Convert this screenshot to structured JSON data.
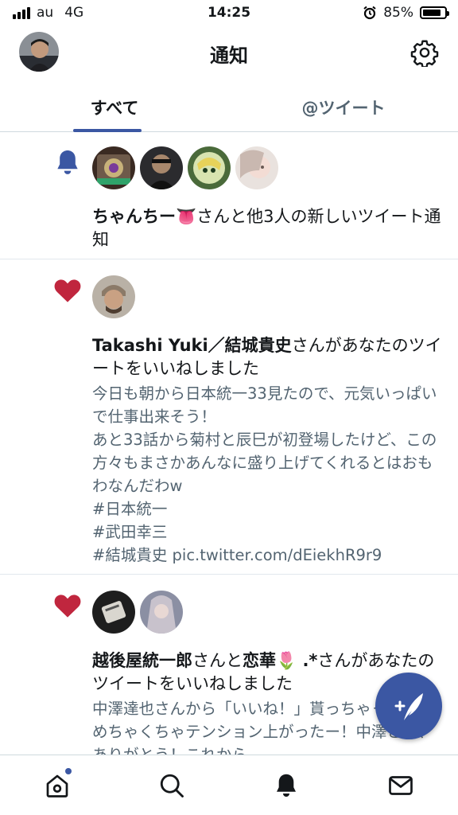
{
  "status": {
    "carrier": "au",
    "network": "4G",
    "time": "14:25",
    "battery_percent": "85%",
    "battery_level": 0.85
  },
  "header": {
    "title": "通知"
  },
  "tabs": [
    {
      "label": "すべて",
      "active": true
    },
    {
      "label": "@ツイート",
      "active": false
    }
  ],
  "notifications": [
    {
      "type": "bell-icon",
      "avatar_count": 4,
      "name": "ちゃんちー👅",
      "text": "さんと他3人の新しいツイート通知",
      "body": ""
    },
    {
      "type": "heart-icon",
      "avatar_count": 1,
      "name": "Takashi Yuki／結城貴史",
      "text": "さんがあなたのツイートをいいねしました",
      "body": "今日も朝から日本統一33見たので、元気いっぱいで仕事出来そう！\nあと33話から菊村と辰巳が初登場したけど、この方々もまさかあんなに盛り上げてくれるとはおもわなんだわw\n#日本統一\n#武田幸三\n#結城貴史 pic.twitter.com/dEiekhR9r9"
    },
    {
      "type": "heart-icon",
      "avatar_count": 2,
      "name": "越後屋統一郎",
      "text_mid": "さんと",
      "name2": "恋華🌷 .*",
      "text": "さんがあなたのツイートをいいねしました",
      "body": "中澤達也さんから「いいね！」貰っちゃったー！めちゃくちゃテンション上がったー！中澤さん、ありがとう！これから"
    }
  ],
  "colors": {
    "accent": "#3b57a3",
    "heart": "#c0263e",
    "border": "#e1e8ed",
    "muted": "#536471"
  },
  "bottom_nav": [
    "home-icon",
    "search-icon",
    "notifications-icon",
    "messages-icon"
  ]
}
